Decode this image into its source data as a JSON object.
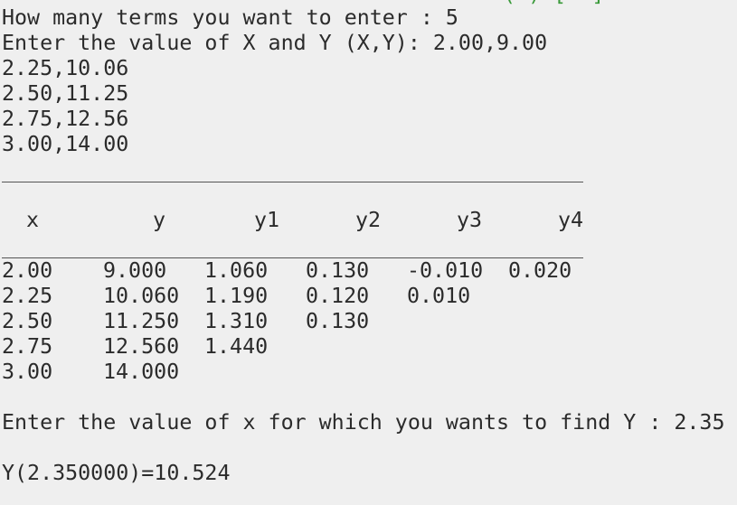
{
  "terminal": {
    "top_fragment_left": "—  '",
    "top_fragment_right": "' (’) [  ]",
    "prompt_terms": "How many terms you want to enter : 5",
    "prompt_xy": "Enter the value of X and Y (X,Y): 2.00,9.00",
    "entries": [
      "2.25,10.06",
      "2.50,11.25",
      "2.75,12.56",
      "3.00,14.00"
    ],
    "table": {
      "headers": [
        "x",
        "y",
        "y1",
        "y2",
        "y3",
        "y4"
      ],
      "rows": [
        {
          "x": "2.00",
          "y": "9.000",
          "y1": "1.060",
          "y2": "0.130",
          "y3": "-0.010",
          "y4": "0.020"
        },
        {
          "x": "2.25",
          "y": "10.060",
          "y1": "1.190",
          "y2": "0.120",
          "y3": "0.010",
          "y4": ""
        },
        {
          "x": "2.50",
          "y": "11.250",
          "y1": "1.310",
          "y2": "0.130",
          "y3": "",
          "y4": ""
        },
        {
          "x": "2.75",
          "y": "12.560",
          "y1": "1.440",
          "y2": "",
          "y3": "",
          "y4": ""
        },
        {
          "x": "3.00",
          "y": "14.000",
          "y1": "",
          "y2": "",
          "y3": "",
          "y4": ""
        }
      ]
    },
    "prompt_find": "Enter the value of x for which you wants to find Y : 2.35",
    "result": "Y(2.350000)=10.524"
  },
  "colors": {
    "background": "#efefef",
    "text": "#2b2b2b",
    "fragment_accent": "#3a9a3a"
  }
}
